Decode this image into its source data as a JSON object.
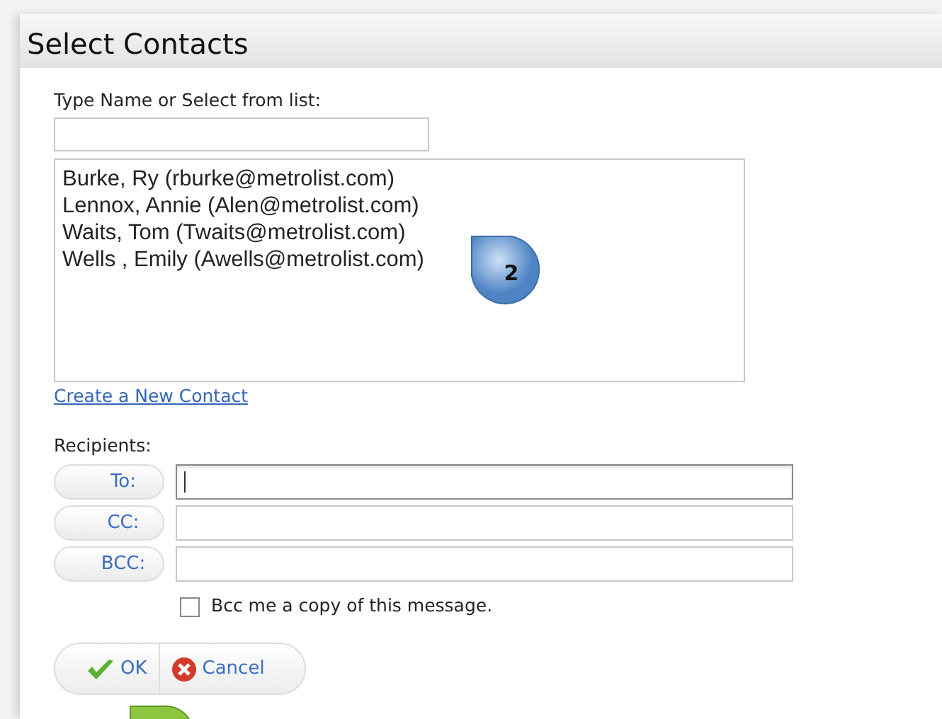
{
  "window": {
    "title": "Select Contacts"
  },
  "search": {
    "label": "Type Name or Select from list:"
  },
  "contacts": [
    {
      "text": "Burke, Ry (rburke@metrolist.com)"
    },
    {
      "text": "Lennox, Annie (Alen@metrolist.com)"
    },
    {
      "text": "Waits, Tom (Twaits@metrolist.com)"
    },
    {
      "text": "Wells , Emily (Awells@metrolist.com)"
    }
  ],
  "callout": {
    "text": "2"
  },
  "create_link": "Create a New Contact",
  "recipients": {
    "label": "Recipients:",
    "rows": [
      {
        "button": "To:",
        "focused": true
      },
      {
        "button": "CC:",
        "focused": false
      },
      {
        "button": "BCC:",
        "focused": false
      }
    ]
  },
  "bcc_me": {
    "label": "Bcc me a copy of this message.",
    "checked": false
  },
  "buttons": [
    {
      "kind": "ok",
      "label": "OK"
    },
    {
      "kind": "cancel",
      "label": "Cancel"
    }
  ]
}
